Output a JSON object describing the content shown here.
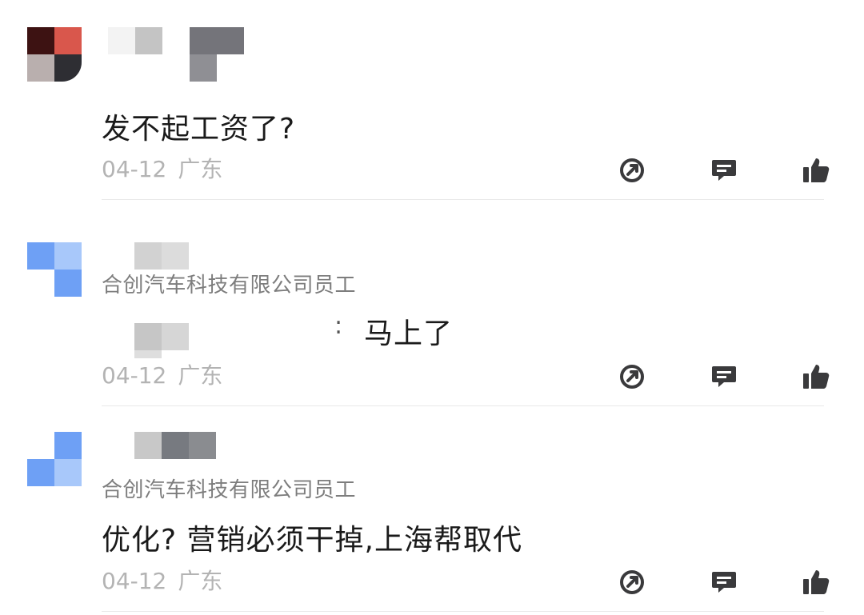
{
  "comments": [
    {
      "text": "发不起工资了?",
      "date": "04-12",
      "location": "广东",
      "colors": [
        "#3d1212",
        "#d9574c",
        "#2e2e33",
        "#8a7a78"
      ]
    },
    {
      "company": "合创汽车科技有限公司员工",
      "reply_sep": ":",
      "text": "马上了",
      "date": "04-12",
      "location": "广东",
      "colors": [
        "#6ea0f5",
        "#a8c8fa",
        "#6ea0f5"
      ]
    },
    {
      "company": "合创汽车科技有限公司员工",
      "text": "优化? 营销必须干掉,上海帮取代",
      "date": "04-12",
      "location": "广东",
      "colors": [
        "#6ea0f5",
        "#a8c8fa",
        "#6ea0f5"
      ]
    }
  ],
  "actions": {
    "share_icon": "share-arrow-icon",
    "reply_icon": "comment-bubble-icon",
    "like_icon": "thumbs-up-icon",
    "icon_color": "#3a3a3c"
  }
}
